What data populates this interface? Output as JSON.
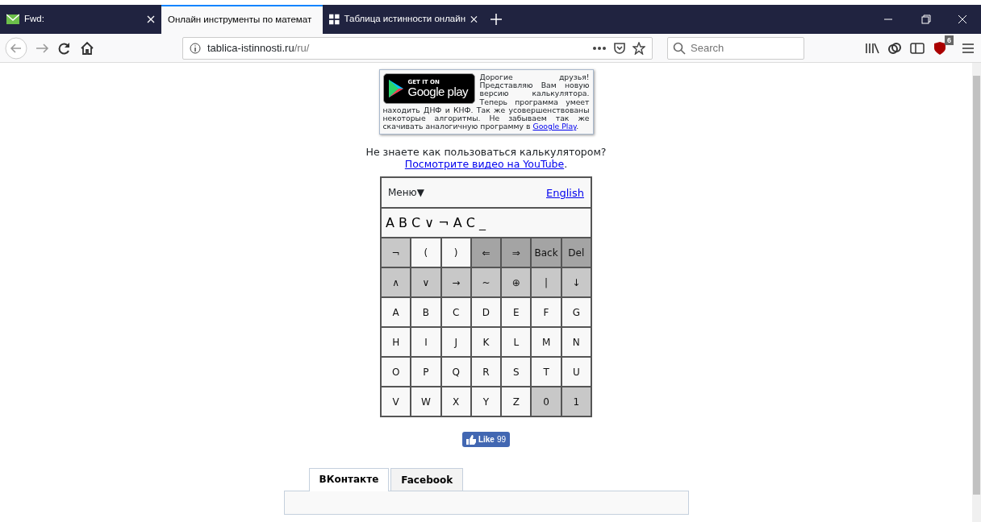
{
  "browser_tabs": [
    {
      "title": "Fwd:",
      "selected": false
    },
    {
      "title": "Онлайн инструменты по математ",
      "selected": true
    },
    {
      "title": "Таблица истинности онлайн",
      "selected": false
    }
  ],
  "address": {
    "host": "tablica-istinnosti.ru",
    "path": "/ru/"
  },
  "search": {
    "placeholder": "Search"
  },
  "addon_badge": "6",
  "promo": {
    "badge_top": "GET IT ON",
    "badge_main": "Google play",
    "text_beside": "Дорогие друзья! Представляю Вам новую версию калькулятора. Теперь программа умеет",
    "text": "находить ДНФ и КНФ. Так же усовершенствованы некоторые алгоритмы. Не забываем так же скачивать аналогичную программу в ",
    "link": "Google Play",
    "after": "."
  },
  "help": {
    "question": "Не знаете как пользоваться калькулятором?",
    "link": "Посмотрите видео на YouTube",
    "after": "."
  },
  "calculator": {
    "menu": "Меню▼",
    "language": "English",
    "expression": "A B C ∨ ¬ A C _",
    "keys": [
      {
        "label": "¬",
        "kind": "op"
      },
      {
        "label": "(",
        "kind": "letter"
      },
      {
        "label": ")",
        "kind": "letter"
      },
      {
        "label": "⇐",
        "kind": "edit"
      },
      {
        "label": "⇒",
        "kind": "edit"
      },
      {
        "label": "Back",
        "kind": "edit"
      },
      {
        "label": "Del",
        "kind": "edit"
      },
      {
        "label": "∧",
        "kind": "op"
      },
      {
        "label": "∨",
        "kind": "op"
      },
      {
        "label": "→",
        "kind": "op"
      },
      {
        "label": "~",
        "kind": "op"
      },
      {
        "label": "⊕",
        "kind": "op"
      },
      {
        "label": "|",
        "kind": "op"
      },
      {
        "label": "↓",
        "kind": "op"
      },
      {
        "label": "A",
        "kind": "letter"
      },
      {
        "label": "B",
        "kind": "letter"
      },
      {
        "label": "C",
        "kind": "letter"
      },
      {
        "label": "D",
        "kind": "letter"
      },
      {
        "label": "E",
        "kind": "letter"
      },
      {
        "label": "F",
        "kind": "letter"
      },
      {
        "label": "G",
        "kind": "letter"
      },
      {
        "label": "H",
        "kind": "letter"
      },
      {
        "label": "I",
        "kind": "letter"
      },
      {
        "label": "J",
        "kind": "letter"
      },
      {
        "label": "K",
        "kind": "letter"
      },
      {
        "label": "L",
        "kind": "letter"
      },
      {
        "label": "M",
        "kind": "letter"
      },
      {
        "label": "N",
        "kind": "letter"
      },
      {
        "label": "O",
        "kind": "letter"
      },
      {
        "label": "P",
        "kind": "letter"
      },
      {
        "label": "Q",
        "kind": "letter"
      },
      {
        "label": "R",
        "kind": "letter"
      },
      {
        "label": "S",
        "kind": "letter"
      },
      {
        "label": "T",
        "kind": "letter"
      },
      {
        "label": "U",
        "kind": "letter"
      },
      {
        "label": "V",
        "kind": "letter"
      },
      {
        "label": "W",
        "kind": "letter"
      },
      {
        "label": "X",
        "kind": "letter"
      },
      {
        "label": "Y",
        "kind": "letter"
      },
      {
        "label": "Z",
        "kind": "letter"
      },
      {
        "label": "0",
        "kind": "op"
      },
      {
        "label": "1",
        "kind": "op"
      }
    ]
  },
  "like": {
    "label": "Like",
    "count": "99"
  },
  "social_tabs": [
    {
      "label": "ВКонтакте",
      "selected": true
    },
    {
      "label": "Facebook",
      "selected": false
    }
  ]
}
